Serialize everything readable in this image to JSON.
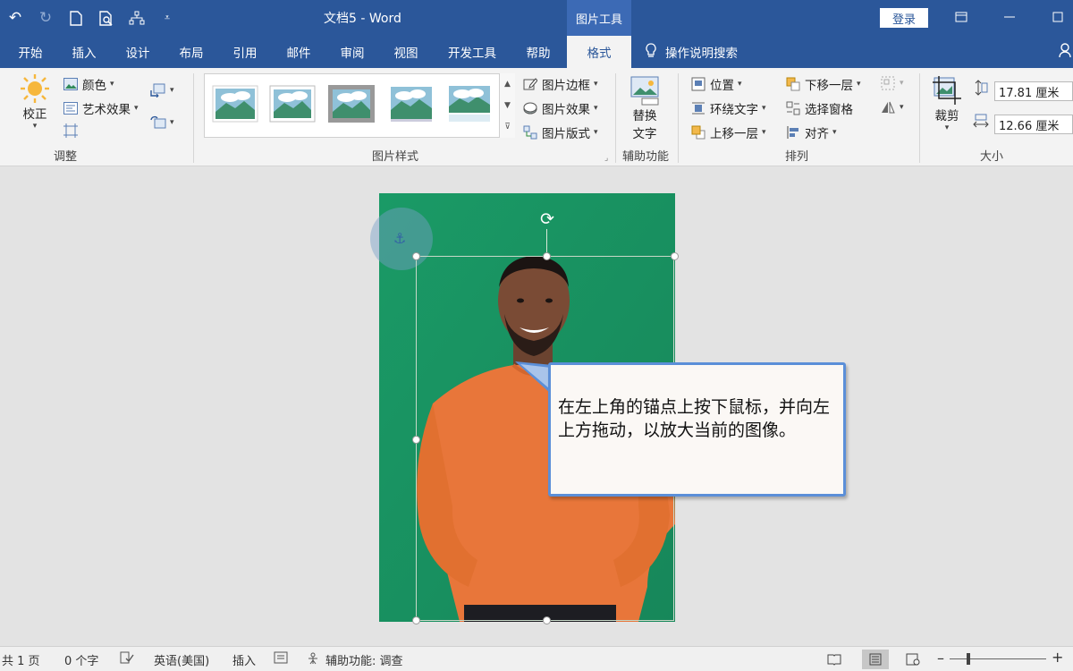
{
  "title_bar": {
    "doc_title": "文档5  -  Word",
    "contextual_tab_group": "图片工具",
    "login": "登录",
    "qat": [
      "undo-icon",
      "redo-icon",
      "new-doc-icon",
      "print-preview-icon",
      "tree-icon",
      "customize-qat-icon"
    ]
  },
  "tabs": [
    "开始",
    "插入",
    "设计",
    "布局",
    "引用",
    "邮件",
    "审阅",
    "视图",
    "开发工具",
    "帮助",
    "格式"
  ],
  "active_tab": "格式",
  "tell_me": "操作说明搜索",
  "ribbon": {
    "adjust": {
      "label": "调整",
      "correct": "校正",
      "color": "颜色",
      "artistic": "艺术效果"
    },
    "picture_styles": {
      "label": "图片样式",
      "border": "图片边框",
      "effects": "图片效果",
      "layout": "图片版式"
    },
    "accessibility": {
      "label": "辅助功能",
      "alt_text_line1": "替换",
      "alt_text_line2": "文字"
    },
    "arrange": {
      "label": "排列",
      "position": "位置",
      "wrap_text": "环绕文字",
      "bring_forward": "上移一层",
      "send_backward": "下移一层",
      "selection_pane": "选择窗格",
      "align": "对齐"
    },
    "size": {
      "label": "大小",
      "crop": "裁剪",
      "height": "17.81 厘米",
      "width": "12.66 厘米"
    }
  },
  "callout": {
    "text": "在左上角的锚点上按下鼠标，并向左上方拖动，以放大当前的图像。"
  },
  "status": {
    "page": "共 1 页",
    "words": "0 个字",
    "language": "英语(美国)",
    "mode": "插入",
    "accessibility": "辅助功能: 调查"
  },
  "colors": {
    "accent": "#2b579a",
    "photo_background": "#1d9464",
    "sweater": "#e8763a",
    "callout_border": "#5b8fd8"
  }
}
